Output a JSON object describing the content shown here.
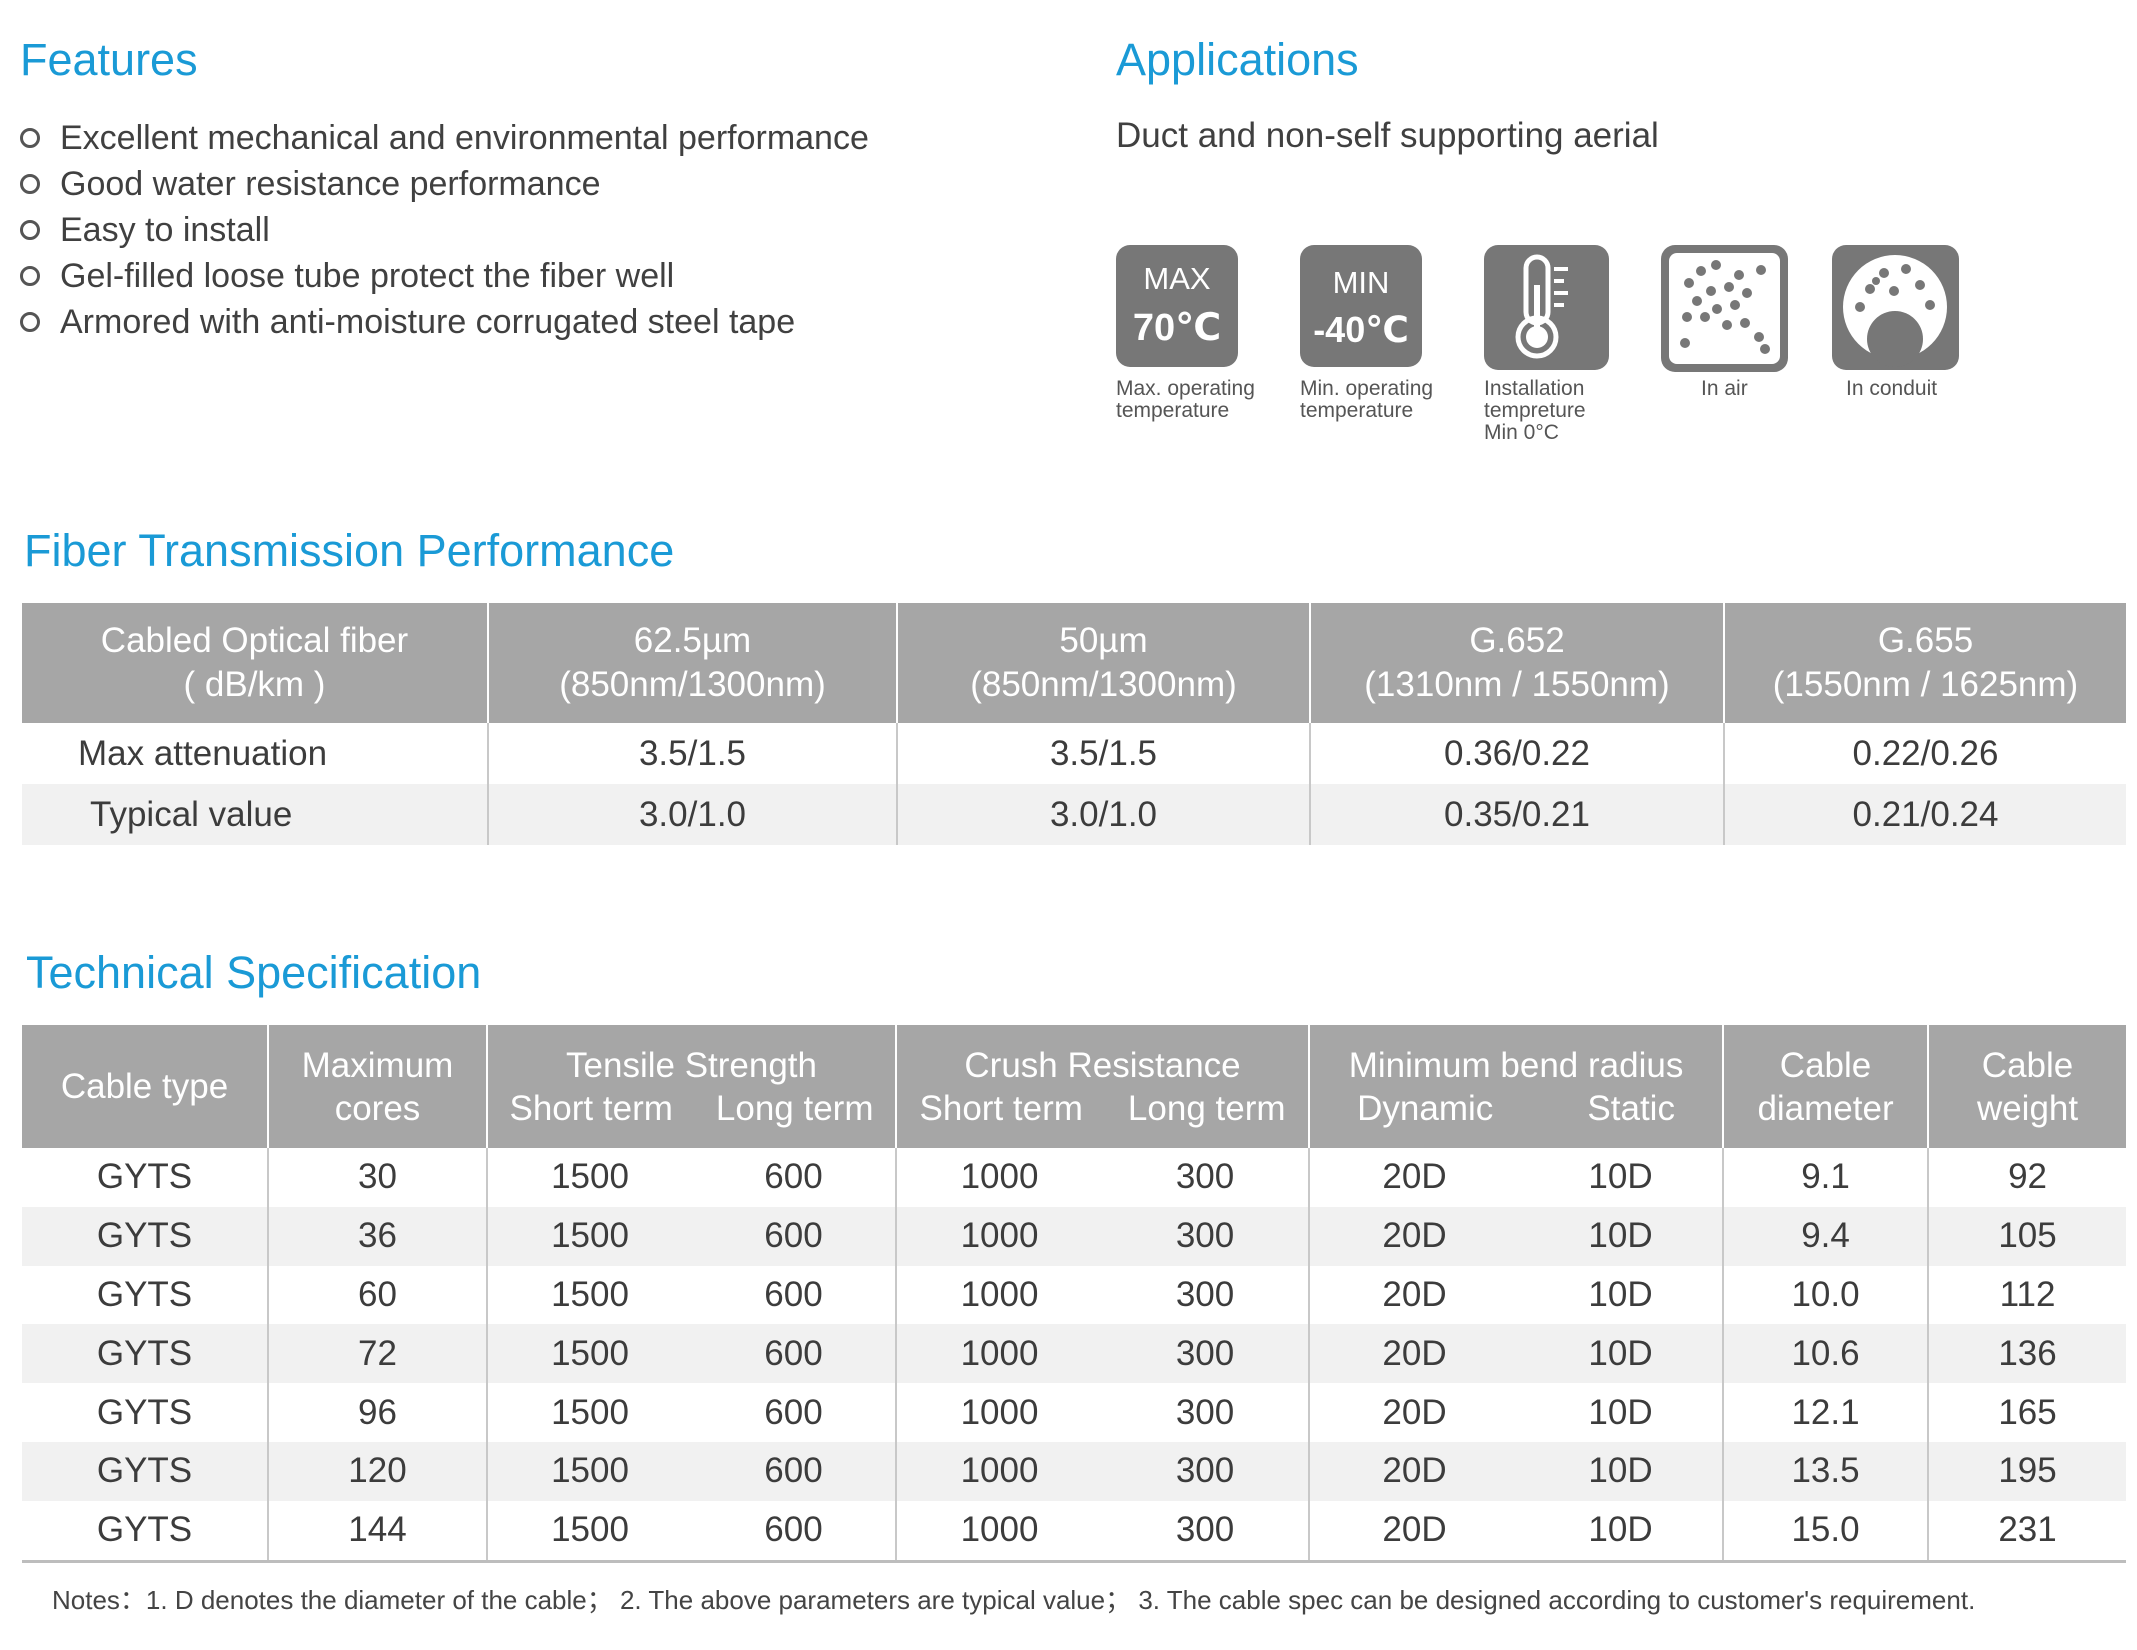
{
  "features": {
    "title": "Features",
    "items": [
      "Excellent mechanical and environmental performance",
      "Good water resistance performance",
      "Easy to install",
      "Gel-filled loose tube protect the fiber well",
      "Armored with anti-moisture corrugated steel tape"
    ]
  },
  "applications": {
    "title": "Applications",
    "text": "Duct and non-self supporting aerial",
    "icons": {
      "max": {
        "label": "MAX",
        "value": "70℃",
        "caption1": "Max. operating",
        "caption2": "temperature"
      },
      "min": {
        "label": "MIN",
        "value": "-40℃",
        "caption1": "Min. operating",
        "caption2": "temperature"
      },
      "install": {
        "caption1": "Installation",
        "caption2": "tempreture",
        "caption3": "Min 0°C",
        "icon": "thermometer-icon"
      },
      "air": {
        "caption": "In air",
        "icon": "in-air-icon"
      },
      "conduit": {
        "caption": "In conduit",
        "icon": "in-conduit-icon"
      }
    }
  },
  "fiber": {
    "title": "Fiber Transmission Performance",
    "header": {
      "c0": {
        "l1": "Cabled Optical fiber",
        "l2": "( dB/km )"
      },
      "c1": {
        "l1": "62.5µm",
        "l2": "(850nm/1300nm)"
      },
      "c2": {
        "l1": "50µm",
        "l2": "(850nm/1300nm)"
      },
      "c3": {
        "l1": "G.652",
        "l2": "(1310nm / 1550nm)"
      },
      "c4": {
        "l1": "G.655",
        "l2": "(1550nm / 1625nm)"
      }
    },
    "rows": [
      [
        "Max attenuation",
        "3.5/1.5",
        "3.5/1.5",
        "0.36/0.22",
        "0.22/0.26"
      ],
      [
        "Typical value",
        "3.0/1.0",
        "3.0/1.0",
        "0.35/0.21",
        "0.21/0.24"
      ]
    ]
  },
  "tech": {
    "title": "Technical Specification",
    "header": {
      "cable_type": "Cable type",
      "max_cores": {
        "l1": "Maximum",
        "l2": "cores"
      },
      "tensile": {
        "l1": "Tensile Strength",
        "short": "Short term",
        "long": "Long term"
      },
      "crush": {
        "l1": "Crush Resistance",
        "short": "Short term",
        "long": "Long term"
      },
      "bend": {
        "l1": "Minimum bend radius",
        "dynamic": "Dynamic",
        "static": "Static"
      },
      "diameter": {
        "l1": "Cable",
        "l2": "diameter"
      },
      "weight": {
        "l1": "Cable",
        "l2": "weight"
      }
    },
    "rows": [
      [
        "GYTS",
        "30",
        "1500",
        "600",
        "1000",
        "300",
        "20D",
        "10D",
        "9.1",
        "92"
      ],
      [
        "GYTS",
        "36",
        "1500",
        "600",
        "1000",
        "300",
        "20D",
        "10D",
        "9.4",
        "105"
      ],
      [
        "GYTS",
        "60",
        "1500",
        "600",
        "1000",
        "300",
        "20D",
        "10D",
        "10.0",
        "112"
      ],
      [
        "GYTS",
        "72",
        "1500",
        "600",
        "1000",
        "300",
        "20D",
        "10D",
        "10.6",
        "136"
      ],
      [
        "GYTS",
        "96",
        "1500",
        "600",
        "1000",
        "300",
        "20D",
        "10D",
        "12.1",
        "165"
      ],
      [
        "GYTS",
        "120",
        "1500",
        "600",
        "1000",
        "300",
        "20D",
        "10D",
        "13.5",
        "195"
      ],
      [
        "GYTS",
        "144",
        "1500",
        "600",
        "1000",
        "300",
        "20D",
        "10D",
        "15.0",
        "231"
      ]
    ],
    "notes": "Notes：1. D denotes the diameter of the cable；   2. The above parameters are typical value；   3. The cable spec can be designed according to customer's requirement."
  }
}
